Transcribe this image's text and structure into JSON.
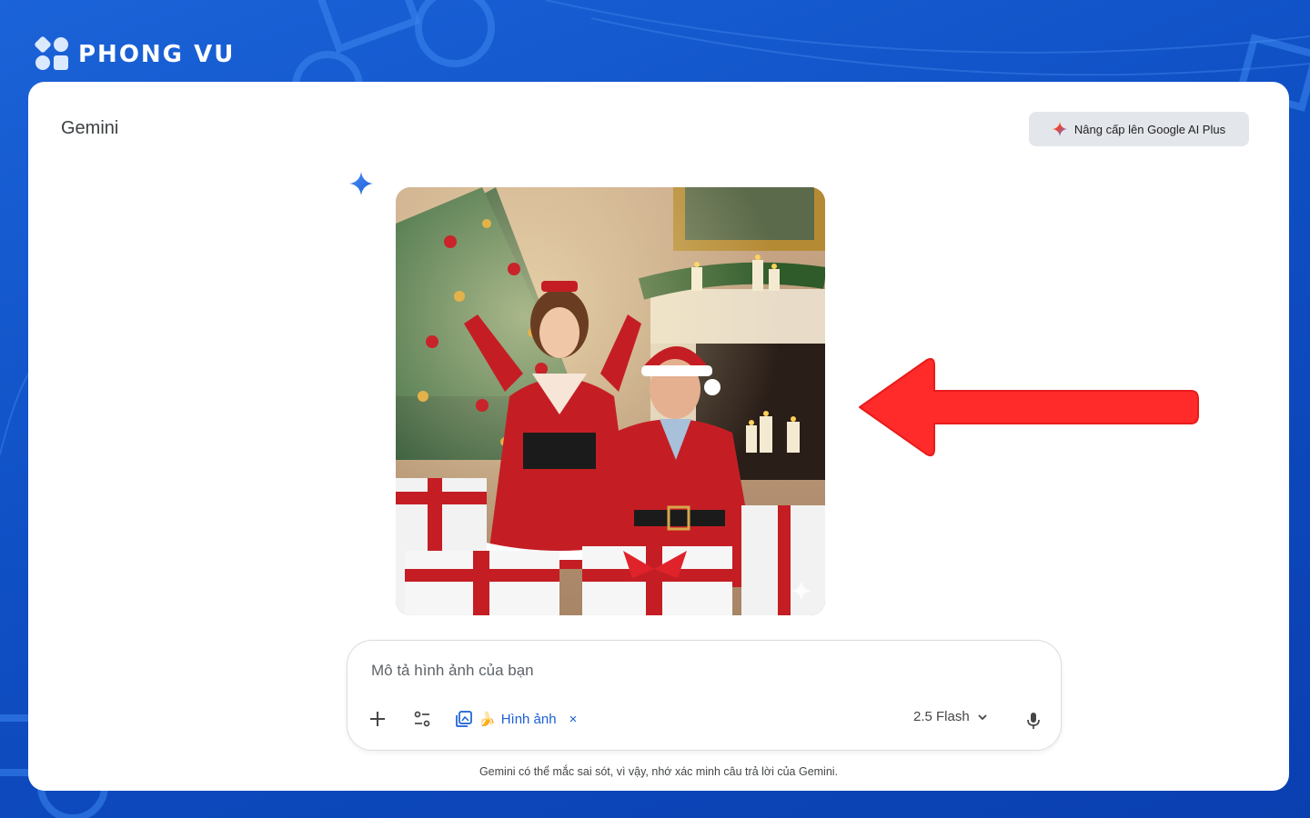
{
  "brand": {
    "name": "PHONG VU"
  },
  "app": {
    "title": "Gemini"
  },
  "upgrade": {
    "label": "Nâng cấp lên Google AI Plus",
    "icon": "gemini-spark-icon"
  },
  "response": {
    "image_description": "generated-christmas-photo",
    "annotation": "red-arrow-left"
  },
  "composer": {
    "placeholder": "Mô tả hình ảnh của bạn",
    "add_icon": "plus-icon",
    "tools_icon": "tools-icon",
    "chip": {
      "label": "Hình ảnh",
      "emoji": "🍌",
      "icon": "image-gallery-icon",
      "remove": "×"
    },
    "model": {
      "label": "2.5 Flash",
      "icon": "chevron-down-icon"
    },
    "mic_icon": "mic-icon"
  },
  "footer": {
    "disclaimer": "Gemini có thể mắc sai sót, vì vậy, nhớ xác minh câu trả lời của Gemini."
  },
  "colors": {
    "background": "#1157cc",
    "accent": "#1a5fd6",
    "arrow": "#ff2a2a"
  }
}
